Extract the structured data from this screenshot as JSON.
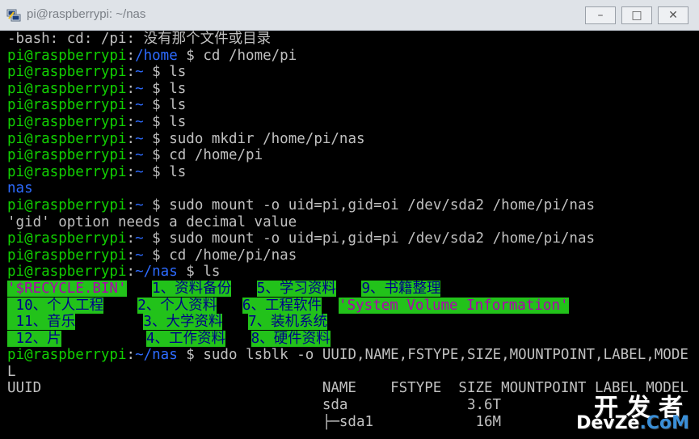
{
  "window": {
    "title": "pi@raspberrypi: ~/nas",
    "min_glyph": "–",
    "max_glyph": "□",
    "close_glyph": "✕"
  },
  "icons": {
    "app": "putty-icon"
  },
  "colors": {
    "background": "#000000",
    "prompt_green": "#11d000",
    "path_blue": "#2d6bff",
    "text_gray": "#c0c0c0",
    "highlight_green": "#22c21a"
  },
  "terminal": {
    "lines": [
      {
        "segments": [
          {
            "t": "-bash: cd: /pi: 没有那个文件或目录",
            "c": "w"
          }
        ]
      },
      {
        "segments": [
          {
            "t": "pi@raspberrypi",
            "c": "g"
          },
          {
            "t": ":",
            "c": "w"
          },
          {
            "t": "/home",
            "c": "b"
          },
          {
            "t": " $ cd /home/pi",
            "c": "w"
          }
        ]
      },
      {
        "segments": [
          {
            "t": "pi@raspberrypi",
            "c": "g"
          },
          {
            "t": ":",
            "c": "w"
          },
          {
            "t": "~",
            "c": "b"
          },
          {
            "t": " $ ls",
            "c": "w"
          }
        ]
      },
      {
        "segments": [
          {
            "t": "pi@raspberrypi",
            "c": "g"
          },
          {
            "t": ":",
            "c": "w"
          },
          {
            "t": "~",
            "c": "b"
          },
          {
            "t": " $ ls",
            "c": "w"
          }
        ]
      },
      {
        "segments": [
          {
            "t": "pi@raspberrypi",
            "c": "g"
          },
          {
            "t": ":",
            "c": "w"
          },
          {
            "t": "~",
            "c": "b"
          },
          {
            "t": " $ ls",
            "c": "w"
          }
        ]
      },
      {
        "segments": [
          {
            "t": "pi@raspberrypi",
            "c": "g"
          },
          {
            "t": ":",
            "c": "w"
          },
          {
            "t": "~",
            "c": "b"
          },
          {
            "t": " $ ls",
            "c": "w"
          }
        ]
      },
      {
        "segments": [
          {
            "t": "pi@raspberrypi",
            "c": "g"
          },
          {
            "t": ":",
            "c": "w"
          },
          {
            "t": "~",
            "c": "b"
          },
          {
            "t": " $ sudo mkdir /home/pi/nas",
            "c": "w"
          }
        ]
      },
      {
        "segments": [
          {
            "t": "pi@raspberrypi",
            "c": "g"
          },
          {
            "t": ":",
            "c": "w"
          },
          {
            "t": "~",
            "c": "b"
          },
          {
            "t": " $ cd /home/pi",
            "c": "w"
          }
        ]
      },
      {
        "segments": [
          {
            "t": "pi@raspberrypi",
            "c": "g"
          },
          {
            "t": ":",
            "c": "w"
          },
          {
            "t": "~",
            "c": "b"
          },
          {
            "t": " $ ls",
            "c": "w"
          }
        ]
      },
      {
        "segments": [
          {
            "t": "nas",
            "c": "b"
          }
        ]
      },
      {
        "segments": [
          {
            "t": "pi@raspberrypi",
            "c": "g"
          },
          {
            "t": ":",
            "c": "w"
          },
          {
            "t": "~",
            "c": "b"
          },
          {
            "t": " $ sudo mount -o uid=pi,gid=oi /dev/sda2 /home/pi/nas",
            "c": "w"
          }
        ]
      },
      {
        "segments": [
          {
            "t": "'gid' option needs a decimal value",
            "c": "w"
          }
        ]
      },
      {
        "segments": [
          {
            "t": "pi@raspberrypi",
            "c": "g"
          },
          {
            "t": ":",
            "c": "w"
          },
          {
            "t": "~",
            "c": "b"
          },
          {
            "t": " $ sudo mount -o uid=pi,gid=pi /dev/sda2 /home/pi/nas",
            "c": "w"
          }
        ]
      },
      {
        "segments": [
          {
            "t": "pi@raspberrypi",
            "c": "g"
          },
          {
            "t": ":",
            "c": "w"
          },
          {
            "t": "~",
            "c": "b"
          },
          {
            "t": " $ cd /home/pi/nas",
            "c": "w"
          }
        ]
      },
      {
        "segments": [
          {
            "t": "pi@raspberrypi",
            "c": "g"
          },
          {
            "t": ":",
            "c": "w"
          },
          {
            "t": "~/nas",
            "c": "b"
          },
          {
            "t": " $ ls",
            "c": "w"
          }
        ]
      },
      {
        "segments": [
          {
            "t": "'$RECYCLE.BIN'",
            "c": "hlp"
          },
          {
            "t": "   ",
            "c": "w"
          },
          {
            "t": "1、资料备份",
            "c": "hl"
          },
          {
            "t": "   ",
            "c": "w"
          },
          {
            "t": "5、学习资料",
            "c": "hl"
          },
          {
            "t": "   ",
            "c": "w"
          },
          {
            "t": "9、书籍整理",
            "c": "hl"
          }
        ]
      },
      {
        "segments": [
          {
            "t": " 10、个人工程",
            "c": "hl"
          },
          {
            "t": "    ",
            "c": "w"
          },
          {
            "t": "2、个人资料",
            "c": "hl"
          },
          {
            "t": "   ",
            "c": "w"
          },
          {
            "t": "6、工程软件",
            "c": "hl"
          },
          {
            "t": "  ",
            "c": "w"
          },
          {
            "t": "'System Volume Information'",
            "c": "hlp"
          }
        ]
      },
      {
        "segments": [
          {
            "t": " 11、音乐",
            "c": "hl"
          },
          {
            "t": "        ",
            "c": "w"
          },
          {
            "t": "3、大学资料",
            "c": "hl"
          },
          {
            "t": "   ",
            "c": "w"
          },
          {
            "t": "7、装机系统",
            "c": "hl"
          }
        ]
      },
      {
        "segments": [
          {
            "t": " 12、片",
            "c": "hl"
          },
          {
            "t": "          ",
            "c": "w"
          },
          {
            "t": "4、工作资料",
            "c": "hl"
          },
          {
            "t": "   ",
            "c": "w"
          },
          {
            "t": "8、硬件资料",
            "c": "hl"
          }
        ]
      },
      {
        "segments": [
          {
            "t": "pi@raspberrypi",
            "c": "g"
          },
          {
            "t": ":",
            "c": "w"
          },
          {
            "t": "~/nas",
            "c": "b"
          },
          {
            "t": " $ sudo lsblk -o UUID,NAME,FSTYPE,SIZE,MOUNTPOINT,LABEL,MODE",
            "c": "w"
          }
        ]
      },
      {
        "segments": [
          {
            "t": "L",
            "c": "w"
          }
        ]
      },
      {
        "segments": [
          {
            "t": "UUID                                 NAME    FSTYPE  SIZE MOUNTPOINT LABEL MODEL",
            "c": "w"
          }
        ]
      },
      {
        "segments": [
          {
            "t": "                                     sda              3.6T",
            "c": "w"
          }
        ]
      },
      {
        "segments": [
          {
            "t": "                                     ├─sda1            16M",
            "c": "w"
          }
        ]
      }
    ]
  },
  "watermark": {
    "cn": "开发者",
    "en_a": "DevZe",
    "en_b": ".CoM"
  }
}
